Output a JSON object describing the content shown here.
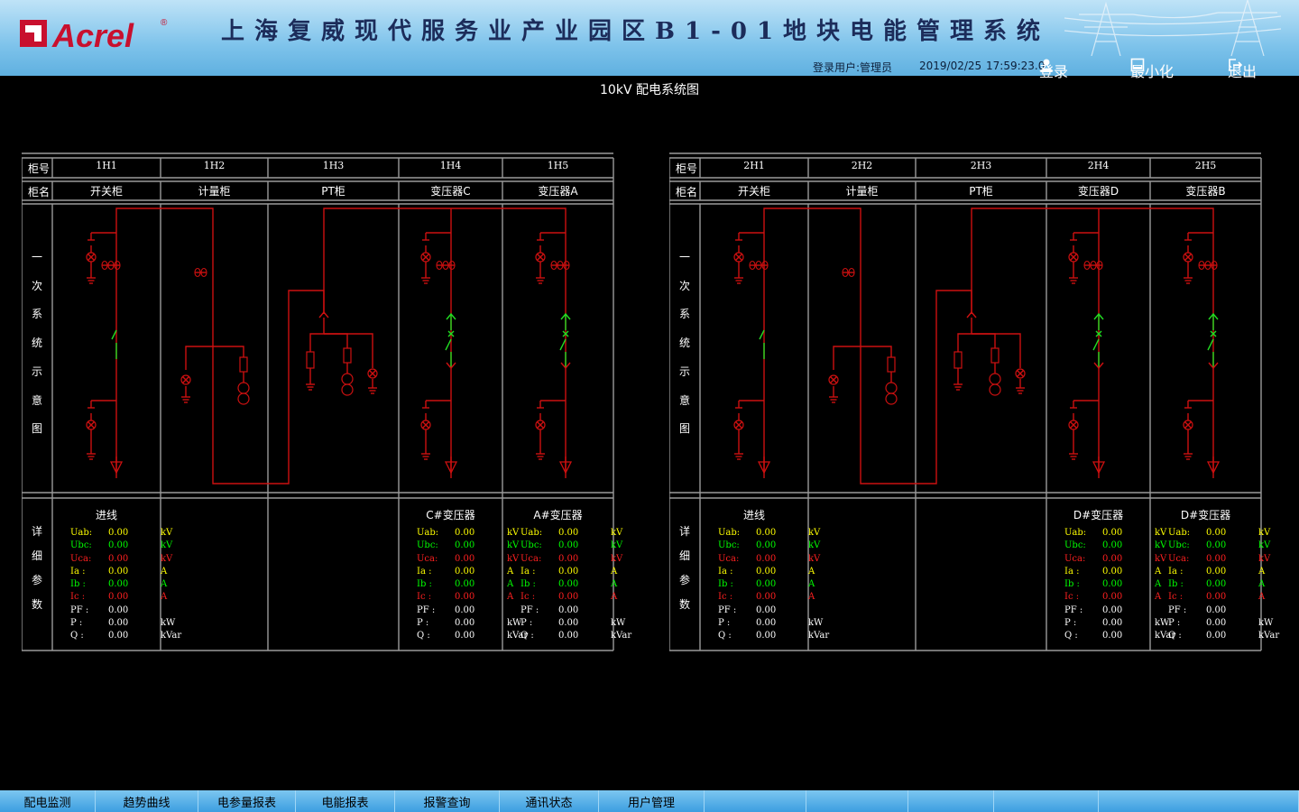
{
  "header": {
    "logo_text": "Acrel",
    "logo_mark": "®",
    "title": "上海复威现代服务业产业园区B1-01地块电能管理系统",
    "login_user": "登录用户:管理员",
    "date": "2019/02/25",
    "time": "17:59:23.0",
    "login_label": "登录",
    "minimize_label": "最小化",
    "exit_label": "退出"
  },
  "page_title": "10kV 配电系统图",
  "labels": {
    "cabinet_no": "柜号",
    "cabinet_name": "柜名",
    "diagram_chars": [
      "一",
      "次",
      "系",
      "统",
      "示",
      "意",
      "图"
    ],
    "params_chars": [
      "详",
      "细",
      "参",
      "数"
    ]
  },
  "panels": [
    {
      "cabinets": [
        {
          "no": "1H1",
          "name": "开关柜"
        },
        {
          "no": "1H2",
          "name": "计量柜"
        },
        {
          "no": "1H3",
          "name": "PT柜"
        },
        {
          "no": "1H4",
          "name": "变压器C"
        },
        {
          "no": "1H5",
          "name": "变压器A"
        }
      ],
      "details": [
        {
          "title": "进线",
          "col": 0
        },
        {
          "title": "C#变压器",
          "col": 3
        },
        {
          "title": "A#变压器",
          "col": 4
        }
      ]
    },
    {
      "cabinets": [
        {
          "no": "2H1",
          "name": "开关柜"
        },
        {
          "no": "2H2",
          "name": "计量柜"
        },
        {
          "no": "2H3",
          "name": "PT柜"
        },
        {
          "no": "2H4",
          "name": "变压器D"
        },
        {
          "no": "2H5",
          "name": "变压器B"
        }
      ],
      "details": [
        {
          "title": "进线",
          "col": 0
        },
        {
          "title": "D#变压器",
          "col": 3
        },
        {
          "title": "D#变压器",
          "col": 4
        }
      ]
    }
  ],
  "param_rows": [
    {
      "key": "Uab:",
      "value": "0.00",
      "unit": "kV",
      "color": "#ffff00"
    },
    {
      "key": "Ubc:",
      "value": "0.00",
      "unit": "kV",
      "color": "#00ff00"
    },
    {
      "key": "Uca:",
      "value": "0.00",
      "unit": "kV",
      "color": "#ff2020"
    },
    {
      "key": "Ia :",
      "value": "0.00",
      "unit": "A",
      "color": "#ffff00"
    },
    {
      "key": "Ib :",
      "value": "0.00",
      "unit": "A",
      "color": "#00ff00"
    },
    {
      "key": "Ic :",
      "value": "0.00",
      "unit": "A",
      "color": "#ff2020"
    },
    {
      "key": "PF :",
      "value": "0.00",
      "unit": "",
      "color": "#ffffff"
    },
    {
      "key": "P  :",
      "value": "0.00",
      "unit": "kW",
      "color": "#ffffff"
    },
    {
      "key": "Q  :",
      "value": "0.00",
      "unit": "kVar",
      "color": "#ffffff"
    }
  ],
  "nav": [
    "配电监测",
    "趋势曲线",
    "电参量报表",
    "电能报表",
    "报警查询",
    "通讯状态",
    "用户管理",
    "",
    "",
    "",
    "",
    ""
  ],
  "colors": {
    "line": "#cc1010",
    "switch_green": "#22dd22",
    "grid": "#9a9a9a",
    "header_bg": "#7ec3eb",
    "nav_bg": "#5fb0e0"
  }
}
